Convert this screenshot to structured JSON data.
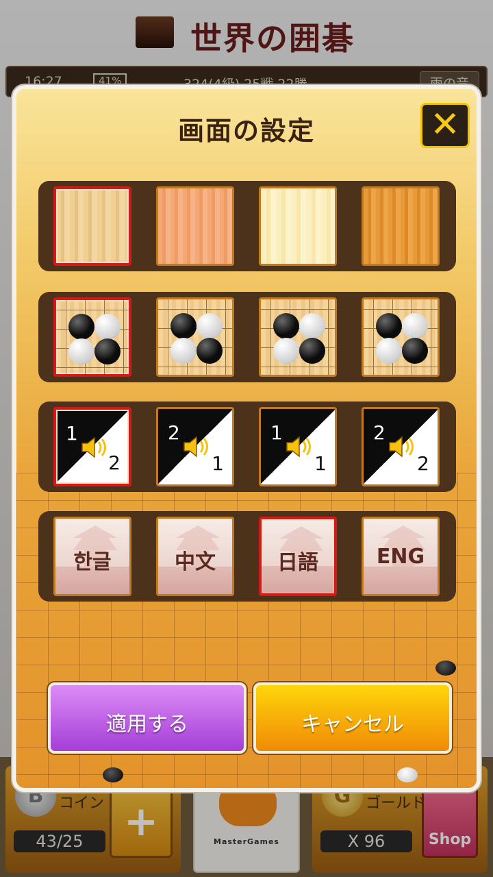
{
  "app": {
    "title": "世界の囲碁",
    "status": {
      "time": "16:27",
      "battery": "41%",
      "rank": "324(4級) 25戦 22勝",
      "sound": "雨の音"
    }
  },
  "dialog": {
    "title": "画面の設定",
    "close_icon": "close-icon",
    "rows": {
      "board": {
        "selected_index": 0
      },
      "stones": {
        "selected_index": 0
      },
      "sound": {
        "selected_index": 0,
        "options": [
          {
            "top": "1",
            "bottom": "2"
          },
          {
            "top": "2",
            "bottom": "1"
          },
          {
            "top": "1",
            "bottom": "1"
          },
          {
            "top": "2",
            "bottom": "2"
          }
        ]
      },
      "language": {
        "selected_index": 2,
        "options": [
          "한글",
          "中文",
          "日語",
          "ENG"
        ]
      }
    },
    "apply_label": "適用する",
    "cancel_label": "キャンセル"
  },
  "bottom": {
    "coin_label": "コイン",
    "coin_icon": "B",
    "coin_count": "43/25",
    "plus_label": "+",
    "mastergames": "MasterGames",
    "gold_label": "ゴールド",
    "gold_icon": "G",
    "gold_count": "X 96",
    "shop_label": "Shop"
  }
}
